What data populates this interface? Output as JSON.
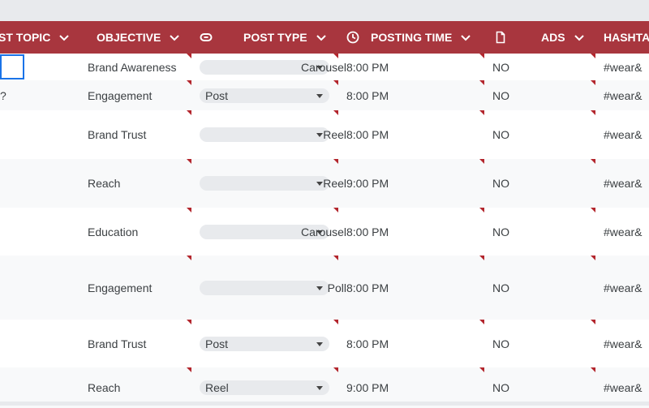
{
  "header": {
    "columns": [
      {
        "label": "ST TOPIC"
      },
      {
        "label": "OBJECTIVE"
      },
      {
        "label": "POST TYPE"
      },
      {
        "label": "POSTING TIME"
      },
      {
        "label": "ADS"
      },
      {
        "label": "HASHTA"
      }
    ],
    "icons": [
      "link-chip-icon",
      "clock-icon",
      "document-icon"
    ]
  },
  "colors": {
    "header_bg": "#a8363e",
    "header_text": "#ffffff",
    "alt_row": "#f8f9fa",
    "flag": "#b3262d",
    "chip": "#e8eaed",
    "selection": "#1a73e8"
  },
  "rows": [
    {
      "topic": "",
      "objective": "Brand Awareness",
      "post_type": "",
      "post_type_overflow": "Carousel",
      "time": "8:00 PM",
      "ads": "NO",
      "hashtag": "#wear&"
    },
    {
      "topic": "?",
      "objective": "Engagement",
      "post_type": "Post",
      "post_type_overflow": "",
      "time": "8:00 PM",
      "ads": "NO",
      "hashtag": "#wear&"
    },
    {
      "topic": "",
      "objective": "Brand Trust",
      "post_type": "",
      "post_type_overflow": "Reel",
      "time": "8:00 PM",
      "ads": "NO",
      "hashtag": "#wear& "
    },
    {
      "topic": "",
      "objective": "Reach",
      "post_type": "",
      "post_type_overflow": "Reel",
      "time": "9:00 PM",
      "ads": "NO",
      "hashtag": "#wear&"
    },
    {
      "topic": "",
      "objective": "Education",
      "post_type": "",
      "post_type_overflow": "Carousel",
      "time": "8:00 PM",
      "ads": "NO",
      "hashtag": "#wear& "
    },
    {
      "topic": "",
      "objective": "Engagement",
      "post_type": "",
      "post_type_overflow": "Poll",
      "time": "8:00 PM",
      "ads": "NO",
      "hashtag": "#wear&"
    },
    {
      "topic": "",
      "objective": "Brand Trust",
      "post_type": "Post",
      "post_type_overflow": "",
      "time": "8:00 PM",
      "ads": "NO",
      "hashtag": "#wear&"
    },
    {
      "topic": "",
      "objective": "Reach",
      "post_type": "Reel",
      "post_type_overflow": "",
      "time": "9:00 PM",
      "ads": "NO",
      "hashtag": "#wear&"
    }
  ]
}
